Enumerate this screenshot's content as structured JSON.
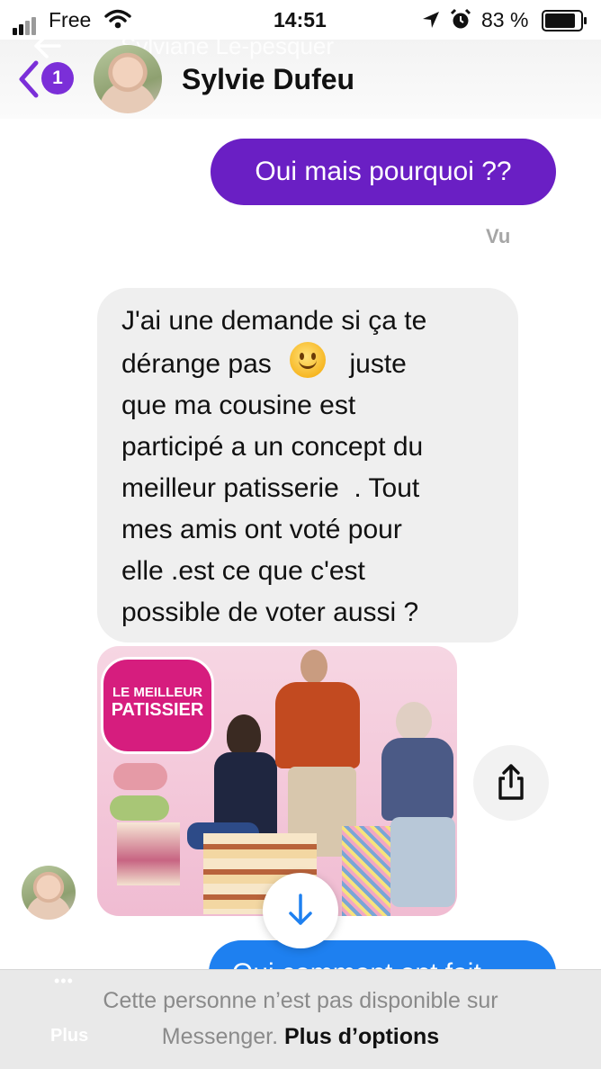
{
  "status": {
    "carrier": "Free",
    "time": "14:51",
    "battery": "83 %"
  },
  "header": {
    "badge_count": "1",
    "overlay_name": "Sylviane Le-pesquer",
    "contact_name": "Sylvie Dufeu"
  },
  "messages": {
    "outgoing_1": "Oui mais pourquoi ??",
    "seen_label": "Vu",
    "incoming_lines": [
      "J'ai une demande si ça te",
      "dérange pas",
      "juste",
      "que ma cousine est",
      "participé a un concept du",
      "meilleur patisserie  . Tout",
      "mes amis ont voté pour",
      "elle .est ce que c'est",
      "possible de voter aussi ?"
    ],
    "outgoing_2_partial": "Oui comment ont fait"
  },
  "image_card": {
    "logo_line1": "LE MEILLEUR",
    "logo_line2": "PATISSIER"
  },
  "footer": {
    "dots": "•••",
    "more_label": "Plus",
    "unavailable_line1": "Cette personne n’est pas disponible sur",
    "unavailable_line2": "Messenger.",
    "more_options": "Plus d’options"
  },
  "colors": {
    "outgoing_bubble": "#6a1fc4",
    "outgoing_bubble_2": "#1e80f0",
    "incoming_bubble": "#efefef",
    "badge": "#7b2fd8",
    "logo_magenta": "#d61d7e"
  },
  "icons": [
    "signal-icon",
    "wifi-icon",
    "location-arrow-icon",
    "alarm-icon",
    "battery-icon",
    "back-chevron-icon",
    "back-arrow-icon",
    "share-icon",
    "scroll-down-arrow-icon",
    "smiley-emoji-icon"
  ]
}
